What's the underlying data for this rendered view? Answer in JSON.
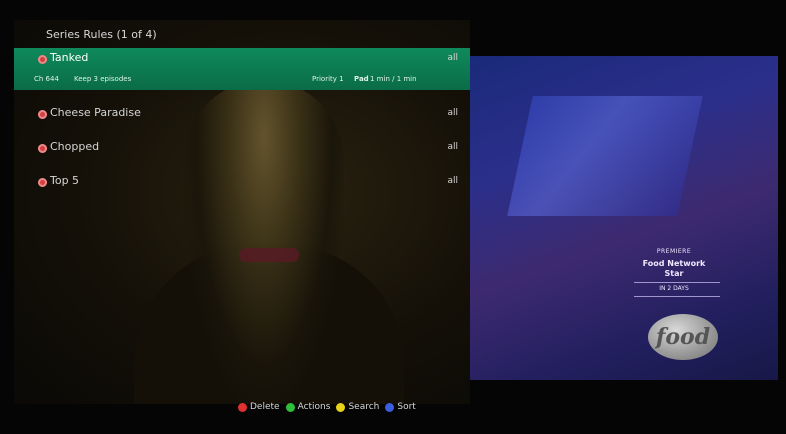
{
  "header": {
    "title": "Series Rules (1 of 4)"
  },
  "rules": [
    {
      "title": "Tanked",
      "badge": "all",
      "selected": true,
      "channel": "Ch 644",
      "keep": "Keep 3 episodes",
      "priority": "Priority 1",
      "pad_label": "Pad",
      "pad_value": "1 min / 1 min"
    },
    {
      "title": "Cheese Paradise",
      "badge": "all"
    },
    {
      "title": "Chopped",
      "badge": "all"
    },
    {
      "title": "Top 5",
      "badge": "all"
    }
  ],
  "promo": {
    "line1": "PREMIERE",
    "line2": "Food Network",
    "line3": "Star",
    "line4": "IN 2 DAYS",
    "logo": "food"
  },
  "footer": {
    "delete": "Delete",
    "actions": "Actions",
    "search": "Search",
    "sort": "Sort"
  },
  "colors": {
    "selection": "#0f8a5c",
    "record_icon": "#d34040",
    "delete_key": "#e03030",
    "actions_key": "#2fbf3a",
    "search_key": "#e8d21a",
    "sort_key": "#3a5ee0"
  }
}
